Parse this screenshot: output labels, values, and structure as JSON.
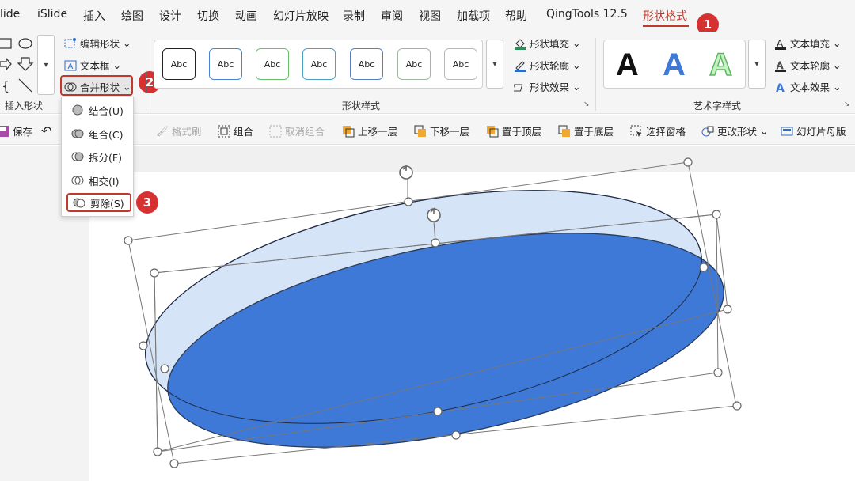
{
  "tabs": [
    "lide",
    "iSlide",
    "插入",
    "绘图",
    "设计",
    "切换",
    "动画",
    "幻灯片放映",
    "录制",
    "审阅",
    "视图",
    "加载项",
    "帮助",
    "QingTools 12.5",
    "形状格式"
  ],
  "ribbon": {
    "insert_shapes": {
      "edit_shape": "编辑形状",
      "text_box": "文本框",
      "merge_shapes": "合并形状",
      "group_label": "插入形状"
    },
    "shape_styles": {
      "samples": [
        "Abc",
        "Abc",
        "Abc",
        "Abc",
        "Abc",
        "Abc",
        "Abc"
      ],
      "fill": "形状填充",
      "outline": "形状轮廓",
      "effects": "形状效果",
      "group_label": "形状样式"
    },
    "wordart": {
      "letters": [
        "A",
        "A",
        "A"
      ],
      "text_fill": "文本填充",
      "text_outline": "文本轮廓",
      "text_effects": "文本效果",
      "group_label": "艺术字样式"
    }
  },
  "toolbar": {
    "save": "保存",
    "format_painter": "格式刷",
    "group": "组合",
    "ungroup": "取消组合",
    "bring_forward": "上移一层",
    "send_backward": "下移一层",
    "bring_to_front": "置于顶层",
    "send_to_back": "置于底层",
    "selection_pane": "选择窗格",
    "change_shape": "更改形状",
    "slide_master": "幻灯片母版"
  },
  "merge_menu": {
    "items": [
      "结合(U)",
      "组合(C)",
      "拆分(F)",
      "相交(I)",
      "剪除(S)"
    ],
    "selected_index": 4
  },
  "badges": [
    "1",
    "2",
    "3"
  ],
  "colors": {
    "accent_red": "#c0392b",
    "badge_red": "#d63031",
    "ellipse_front": "#3e79d7",
    "ellipse_back": "#d6e4f7"
  }
}
